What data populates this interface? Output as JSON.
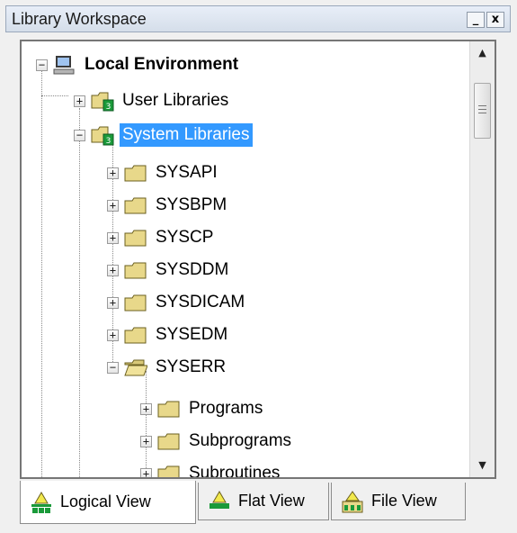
{
  "window": {
    "title": "Library Workspace",
    "minimize_label": "_",
    "close_label": "x"
  },
  "tree": {
    "root": {
      "label": "Local Environment",
      "expander": "−"
    },
    "user_libraries": {
      "label": "User Libraries",
      "expander": "+"
    },
    "system_libraries": {
      "label": "System Libraries",
      "expander": "−"
    },
    "libs": [
      {
        "label": "SYSAPI",
        "expander": "+"
      },
      {
        "label": "SYSBPM",
        "expander": "+"
      },
      {
        "label": "SYSCP",
        "expander": "+"
      },
      {
        "label": "SYSDDM",
        "expander": "+"
      },
      {
        "label": "SYSDICAM",
        "expander": "+"
      },
      {
        "label": "SYSEDM",
        "expander": "+"
      },
      {
        "label": "SYSERR",
        "expander": "−"
      }
    ],
    "syserr_children": [
      {
        "label": "Programs",
        "expander": "+"
      },
      {
        "label": "Subprograms",
        "expander": "+"
      },
      {
        "label": "Subroutines",
        "expander": "+"
      }
    ],
    "lib_badge": "3"
  },
  "tabs": [
    {
      "label": "Logical View",
      "active": true
    },
    {
      "label": "Flat View",
      "active": false
    },
    {
      "label": "File View",
      "active": false
    }
  ],
  "colors": {
    "selection": "#3399ff",
    "folder": "#e8d88a",
    "badge": "#1a9a3a"
  }
}
